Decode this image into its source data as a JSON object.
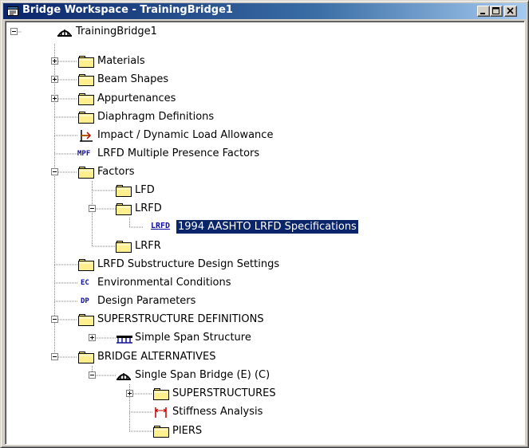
{
  "window": {
    "title": "Bridge Workspace - TrainingBridge1"
  },
  "colors": {
    "title_active": "#0a246a",
    "selection": "#0a246a",
    "folder": "#ffef8f"
  },
  "tree": {
    "root": "TrainingBridge1",
    "materials": "Materials",
    "beam_shapes": "Beam Shapes",
    "appurtenances": "Appurtenances",
    "diaphragm_definitions": "Diaphragm Definitions",
    "impact": "Impact / Dynamic Load Allowance",
    "mpf_icon": "MPF",
    "mpf": "LRFD Multiple Presence Factors",
    "factors": "Factors",
    "lfd": "LFD",
    "lrfd": "LRFD",
    "lrfd_icon": "LRFD",
    "lrfd_spec": "1994 AASHTO LRFD Specifications",
    "lrfr": "LRFR",
    "substructure_settings": "LRFD Substructure Design Settings",
    "ec_icon": "EC",
    "environmental": "Environmental Conditions",
    "dp_icon": "DP",
    "design_parameters": "Design Parameters",
    "superstructure_definitions": "SUPERSTRUCTURE DEFINITIONS",
    "simple_span_structure": "Simple Span Structure",
    "bridge_alternatives": "BRIDGE ALTERNATIVES",
    "single_span_bridge": "Single Span Bridge (E) (C)",
    "superstructures": "SUPERSTRUCTURES",
    "stiffness_analysis": "Stiffness Analysis",
    "piers": "PIERS"
  }
}
